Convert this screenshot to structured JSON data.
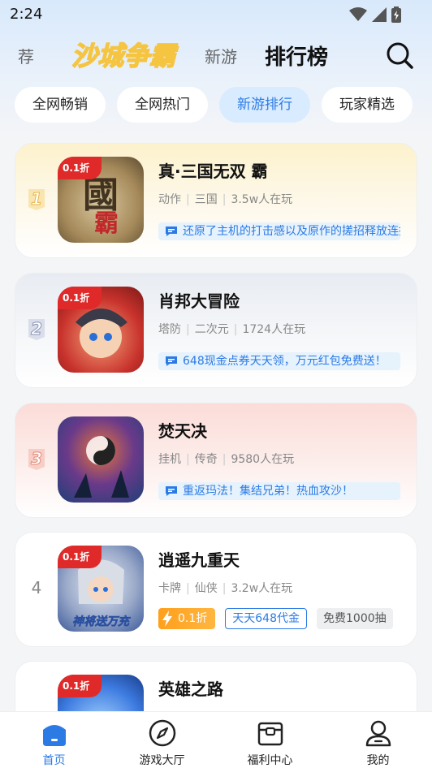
{
  "status_bar": {
    "time": "2:24"
  },
  "header": {
    "tab_prev": "荐",
    "brand": "沙城争霸",
    "tab_new": "新游",
    "tab_rank": "排行榜"
  },
  "filters": [
    "全网畅销",
    "全网热门",
    "新游排行",
    "玩家精选"
  ],
  "active_filter": 2,
  "games": [
    {
      "rank": "1",
      "title": "真·三国无双 霸",
      "genre": "动作",
      "theme": "三国",
      "players": "3.5w人在玩",
      "desc": "还原了主机的打击感以及原作的搓招释放连招",
      "discount": "0.1折"
    },
    {
      "rank": "2",
      "title": "肖邦大冒险",
      "genre": "塔防",
      "theme": "二次元",
      "players": "1724人在玩",
      "desc": "648现金点券天天领，万元红包免费送！",
      "discount": "0.1折"
    },
    {
      "rank": "3",
      "title": "焚天决",
      "genre": "挂机",
      "theme": "传奇",
      "players": "9580人在玩",
      "desc": "重返玛法！集结兄弟！热血攻沙！",
      "discount": ""
    },
    {
      "rank": "4",
      "title": "逍遥九重天",
      "genre": "卡牌",
      "theme": "仙侠",
      "players": "3.2w人在玩",
      "tags": [
        "0.1折",
        "天天648代金",
        "免费1000抽"
      ],
      "discount": "0.1折",
      "icon_text": "神将送万充"
    },
    {
      "rank": "",
      "title": "英雄之路",
      "discount": "0.1折"
    }
  ],
  "bottom_nav": [
    {
      "label": "首页",
      "icon": "home-icon"
    },
    {
      "label": "游戏大厅",
      "icon": "compass-icon"
    },
    {
      "label": "福利中心",
      "icon": "gift-box-icon"
    },
    {
      "label": "我的",
      "icon": "person-icon"
    }
  ],
  "colors": {
    "accent": "#2c7be5",
    "tag_red": "#e02a2a",
    "tag_orange": "#ff9f1c"
  }
}
